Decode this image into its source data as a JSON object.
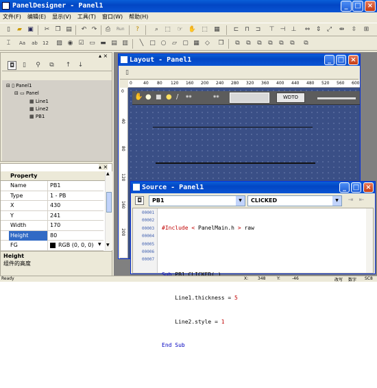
{
  "app": {
    "title": "PanelDesigner - Panel1"
  },
  "menu": [
    "文件(F)",
    "编辑(E)",
    "显示(V)",
    "工具(T)",
    "窗口(W)",
    "帮助(H)"
  ],
  "toolbar": {
    "run_label": "Run"
  },
  "tree": {
    "items": [
      "Panel1",
      "Panel",
      "Line1",
      "Line2",
      "PB1"
    ]
  },
  "properties": {
    "header": "Property",
    "rows": [
      {
        "name": "Name",
        "value": "PB1"
      },
      {
        "name": "Type",
        "value": "1 - PB"
      },
      {
        "name": "X",
        "value": "430"
      },
      {
        "name": "Y",
        "value": "241"
      },
      {
        "name": "Width",
        "value": "170"
      },
      {
        "name": "Height",
        "value": "80"
      },
      {
        "name": "FG",
        "value": "RGB (0, 0, 0)"
      }
    ],
    "selected": "Height",
    "desc_title": "Height",
    "desc_text": "组件的高度"
  },
  "layout": {
    "title": "Layout - Panel1",
    "ruler_h": [
      "0",
      "40",
      "80",
      "120",
      "160",
      "200",
      "240",
      "280",
      "320",
      "360",
      "400",
      "440",
      "480",
      "520",
      "560",
      "600"
    ],
    "ruler_v": [
      "0",
      "40",
      "80",
      "120",
      "160",
      "200"
    ],
    "preview_button": "WDTO"
  },
  "source": {
    "title": "Source - Panel1",
    "object_select": "PB1",
    "event_select": "CLICKED",
    "line_numbers": [
      "00001",
      "00002",
      "00003",
      "00004",
      "00005",
      "00006",
      "00007"
    ],
    "lines": [
      "#Include < PanelMain.h > raw",
      "",
      "Sub PB1_CLICKED( )",
      "    Line1.thickness = 5",
      "    Line2.style = 1",
      "End Sub",
      ""
    ]
  },
  "status": {
    "ready": "Ready",
    "x_label": "X:",
    "x_value": "348",
    "y_label": "Y:",
    "y_value": "-46",
    "ins": "改写",
    "num": "数字",
    "sc": "SC8"
  },
  "colors": {
    "title_bar": "#0a54d4",
    "canvas": "#3a4f86",
    "keyword": "#0000c0",
    "number": "#c00000"
  }
}
